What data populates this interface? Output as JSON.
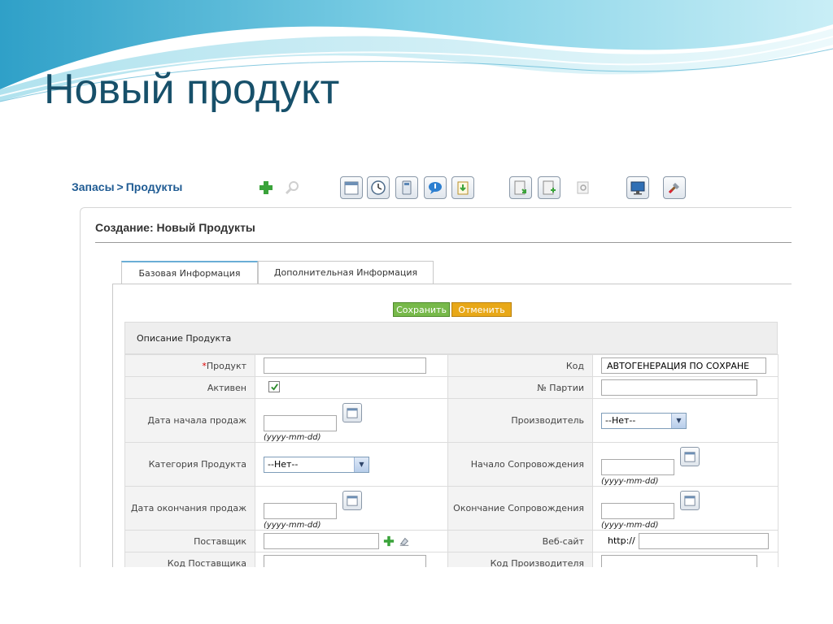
{
  "slide": {
    "title": "Новый продукт"
  },
  "breadcrumb": {
    "parent": "Запасы",
    "separator": ">",
    "current": "Продукты"
  },
  "toolbar": {
    "icons": [
      "add-icon",
      "search-icon",
      "calendar-icon",
      "clock-icon",
      "calculator-icon",
      "chat-icon",
      "import-icon",
      "export-icon",
      "export-alt-icon",
      "find-duplicates-icon",
      "monitor-icon",
      "tools-icon"
    ]
  },
  "panel": {
    "title": "Создание: Новый Продукты"
  },
  "tabs": {
    "basic": "Базовая Информация",
    "additional": "Дополнительная Информация"
  },
  "buttons": {
    "save": "Сохранить",
    "cancel": "Отменить"
  },
  "section": {
    "title": "Описание Продукта"
  },
  "date_hint": "(yyyy-mm-dd)",
  "form": {
    "product_label": "Продукт",
    "required_mark": "*",
    "code_label": "Код",
    "code_value": "АВТОГЕНЕРАЦИЯ ПО СОХРАНЕ",
    "active_label": "Активен",
    "active_checked": true,
    "batch_label": "№ Партии",
    "sales_start_label": "Дата начала продаж",
    "manufacturer_label": "Производитель",
    "manufacturer_value": "--Нет--",
    "category_label": "Категория Продукта",
    "category_value": "--Нет--",
    "support_start_label": "Начало Сопровождения",
    "sales_end_label": "Дата окончания продаж",
    "support_end_label": "Окончание Сопровождения",
    "vendor_label": "Поставщик",
    "website_label": "Веб-сайт",
    "website_prefix": "http://",
    "vendor_code_label": "Код Поставщика",
    "manufacturer_code_label": "Код Производителя"
  },
  "colors": {
    "title": "#17506a",
    "breadcrumb": "#1f5b93",
    "save": "#77b94a",
    "cancel": "#e8a818",
    "tab_accent": "#6aaed6"
  }
}
